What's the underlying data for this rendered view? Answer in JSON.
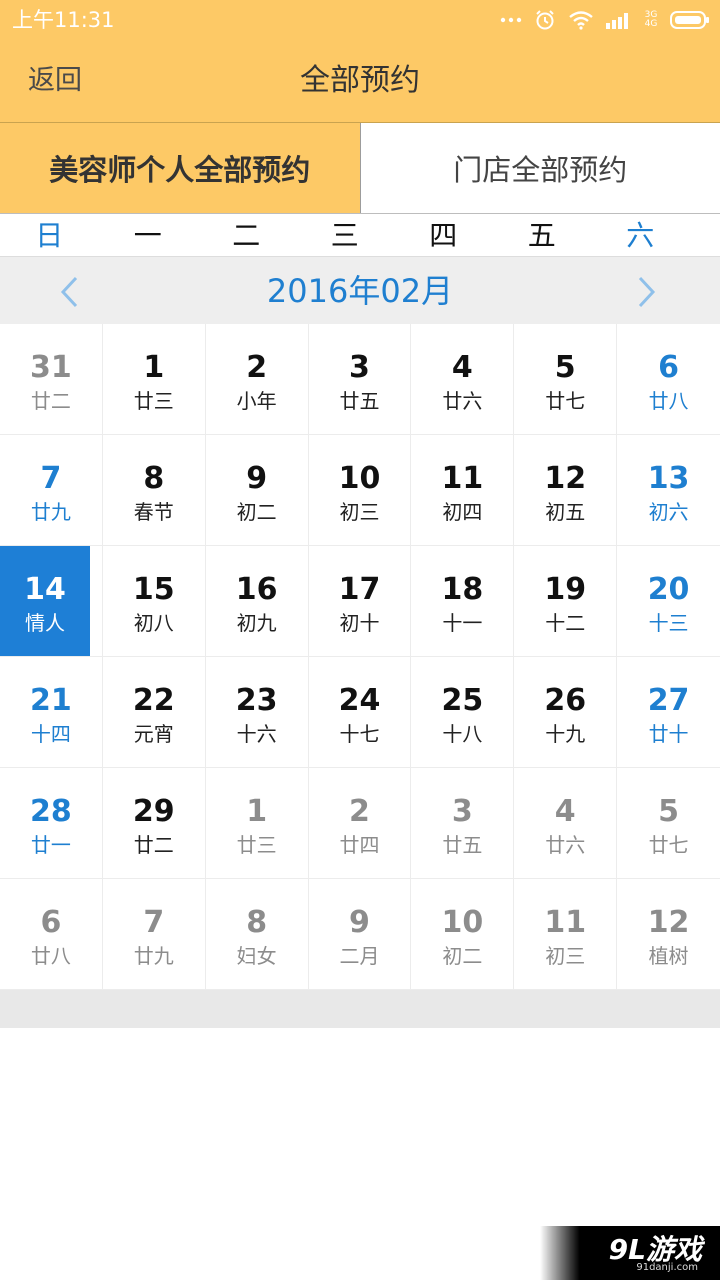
{
  "status_bar": {
    "time": "上午11:31",
    "network": "3G\n4G"
  },
  "header": {
    "back_label": "返回",
    "title": "全部预约"
  },
  "tabs": [
    {
      "label": "美容师个人全部预约",
      "active": true
    },
    {
      "label": "门店全部预约",
      "active": false
    }
  ],
  "weekdays": [
    "日",
    "一",
    "二",
    "三",
    "四",
    "五",
    "六"
  ],
  "calendar": {
    "month_label": "2016年02月",
    "selected_day": "14",
    "cells": [
      {
        "day": "31",
        "lunar": "廿二",
        "type": "other"
      },
      {
        "day": "1",
        "lunar": "廿三",
        "type": "current"
      },
      {
        "day": "2",
        "lunar": "小年",
        "type": "current"
      },
      {
        "day": "3",
        "lunar": "廿五",
        "type": "current"
      },
      {
        "day": "4",
        "lunar": "廿六",
        "type": "current"
      },
      {
        "day": "5",
        "lunar": "廿七",
        "type": "current"
      },
      {
        "day": "6",
        "lunar": "廿八",
        "type": "weekend"
      },
      {
        "day": "7",
        "lunar": "廿九",
        "type": "weekend"
      },
      {
        "day": "8",
        "lunar": "春节",
        "type": "current"
      },
      {
        "day": "9",
        "lunar": "初二",
        "type": "current"
      },
      {
        "day": "10",
        "lunar": "初三",
        "type": "current"
      },
      {
        "day": "11",
        "lunar": "初四",
        "type": "current"
      },
      {
        "day": "12",
        "lunar": "初五",
        "type": "current"
      },
      {
        "day": "13",
        "lunar": "初六",
        "type": "weekend"
      },
      {
        "day": "14",
        "lunar": "情人",
        "type": "selected"
      },
      {
        "day": "15",
        "lunar": "初八",
        "type": "current"
      },
      {
        "day": "16",
        "lunar": "初九",
        "type": "current"
      },
      {
        "day": "17",
        "lunar": "初十",
        "type": "current"
      },
      {
        "day": "18",
        "lunar": "十一",
        "type": "current"
      },
      {
        "day": "19",
        "lunar": "十二",
        "type": "current"
      },
      {
        "day": "20",
        "lunar": "十三",
        "type": "weekend"
      },
      {
        "day": "21",
        "lunar": "十四",
        "type": "weekend"
      },
      {
        "day": "22",
        "lunar": "元宵",
        "type": "current"
      },
      {
        "day": "23",
        "lunar": "十六",
        "type": "current"
      },
      {
        "day": "24",
        "lunar": "十七",
        "type": "current"
      },
      {
        "day": "25",
        "lunar": "十八",
        "type": "current"
      },
      {
        "day": "26",
        "lunar": "十九",
        "type": "current"
      },
      {
        "day": "27",
        "lunar": "廿十",
        "type": "weekend"
      },
      {
        "day": "28",
        "lunar": "廿一",
        "type": "weekend"
      },
      {
        "day": "29",
        "lunar": "廿二",
        "type": "current"
      },
      {
        "day": "1",
        "lunar": "廿三",
        "type": "other"
      },
      {
        "day": "2",
        "lunar": "廿四",
        "type": "other"
      },
      {
        "day": "3",
        "lunar": "廿五",
        "type": "other"
      },
      {
        "day": "4",
        "lunar": "廿六",
        "type": "other"
      },
      {
        "day": "5",
        "lunar": "廿七",
        "type": "other"
      },
      {
        "day": "6",
        "lunar": "廿八",
        "type": "other"
      },
      {
        "day": "7",
        "lunar": "廿九",
        "type": "other"
      },
      {
        "day": "8",
        "lunar": "妇女",
        "type": "other"
      },
      {
        "day": "9",
        "lunar": "二月",
        "type": "other"
      },
      {
        "day": "10",
        "lunar": "初二",
        "type": "other"
      },
      {
        "day": "11",
        "lunar": "初三",
        "type": "other"
      },
      {
        "day": "12",
        "lunar": "植树",
        "type": "other"
      }
    ]
  },
  "watermark": {
    "logo": "9L游戏",
    "site": "91danji.com"
  },
  "colors": {
    "header_bg": "#fdc966",
    "accent_blue": "#1e7fd0",
    "selected_bg": "#1e7fd6",
    "muted_text": "#8c8c8c"
  },
  "icons": [
    "dots-icon",
    "alarm-icon",
    "wifi-icon",
    "signal-icon",
    "battery-icon",
    "chevron-left-icon",
    "chevron-right-icon"
  ]
}
